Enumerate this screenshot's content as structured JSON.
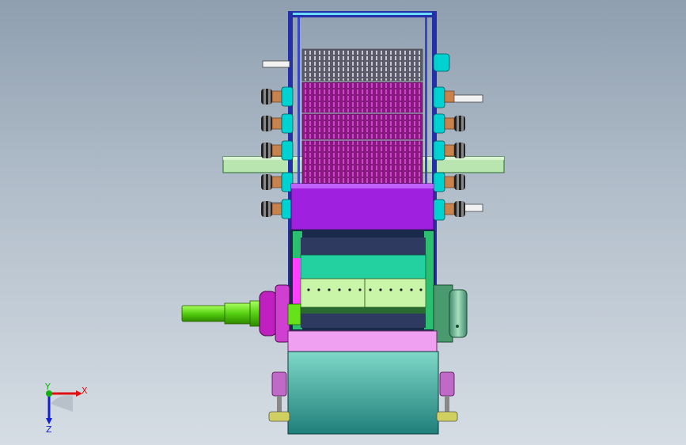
{
  "triad": {
    "x_label": "X",
    "y_label": "Y",
    "z_label": "Z"
  },
  "colors": {
    "background_top": "#8f9fb0",
    "background_bottom": "#d6dde4",
    "frame": "#2430a8",
    "rollers": "#9a1e8f",
    "hub": "#00d2d2",
    "bearing": "#c8824e",
    "housing_purple": "#a020e0",
    "drum_teal": "#3fb0a0",
    "base_teal": "#2f8f88",
    "shaft_green": "#66e21a",
    "light_green": "#c8f5a8",
    "pink": "#f0a0f0",
    "triad_x": "#e01010",
    "triad_y": "#10b010",
    "triad_z": "#1020d0"
  }
}
